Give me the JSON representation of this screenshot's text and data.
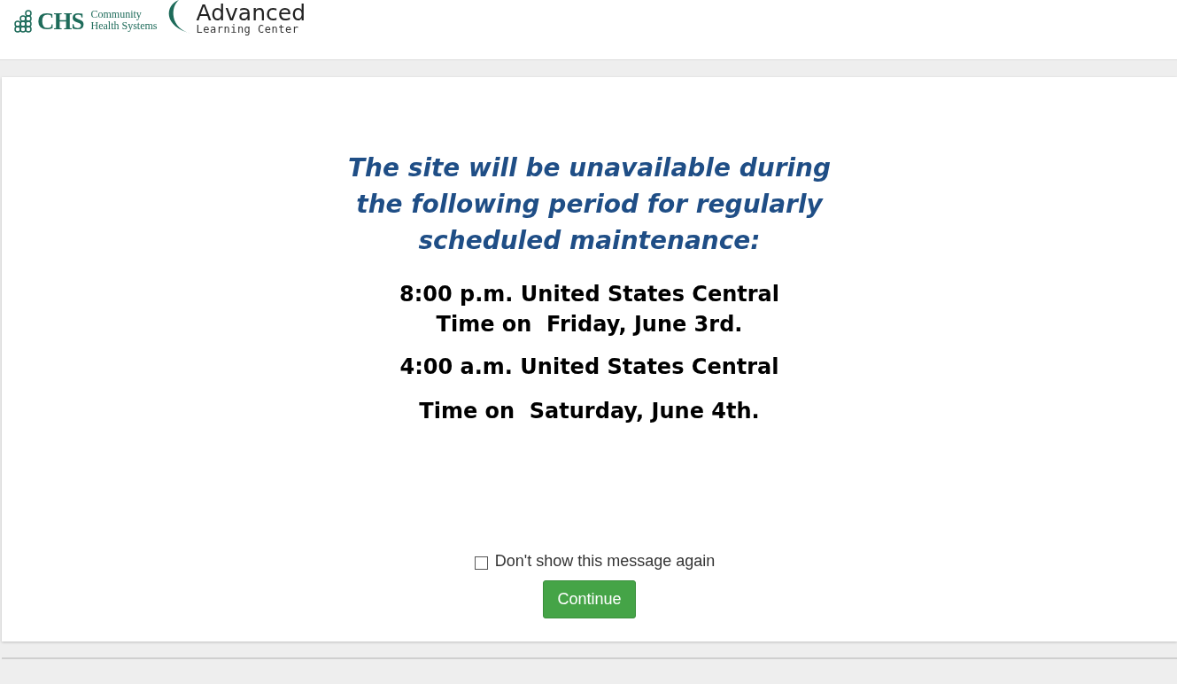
{
  "logo": {
    "chs": "CHS",
    "chs_line1": "Community",
    "chs_line2": "Health Systems",
    "alc_line1": "Advanced",
    "alc_line2": "Learning Center"
  },
  "notice": {
    "heading": "The site will be unavailable during the following period for regularly scheduled maintenance:",
    "lines": [
      "8:00 p.m. United States Central",
      "Time on  Friday, June 3rd.",
      "4:00 a.m. United States Central",
      "Time on  Saturday, June 4th."
    ]
  },
  "dont_show": {
    "label": "Don't show this message again",
    "checked": false
  },
  "continue_button": "Continue"
}
